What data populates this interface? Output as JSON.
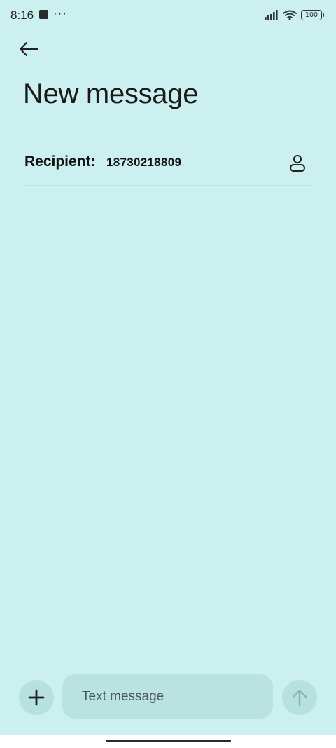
{
  "status_bar": {
    "time": "8:16",
    "dots": "···",
    "battery": "100"
  },
  "header": {
    "title": "New message"
  },
  "recipient": {
    "label": "Recipient:",
    "number": "18730218809"
  },
  "compose": {
    "placeholder": "Text message"
  },
  "icons": {
    "back": "arrow-left-icon",
    "contact": "person-icon",
    "attach": "plus-icon",
    "send": "arrow-up-icon"
  },
  "colors": {
    "background": "#cbf0ef",
    "input_background": "#b9e2e0",
    "button_background": "#b6e1df",
    "send_icon": "#8fb0b0"
  }
}
